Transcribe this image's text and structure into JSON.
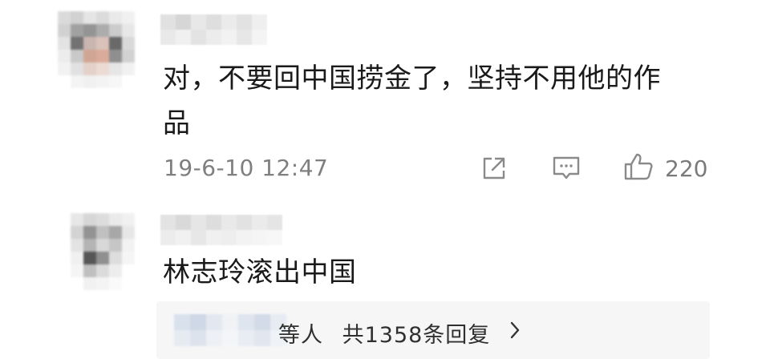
{
  "comments": [
    {
      "text_line1": "对，不要回中国捞金了，坚持不用他的作",
      "text_line2": "品",
      "timestamp": "19-6-10 12:47",
      "actions": {
        "share_icon": "share-icon",
        "reply_icon": "comment-icon",
        "like_icon": "thumbs-up-icon",
        "like_count": "220"
      }
    },
    {
      "text_line1": "林志玲滚出中国"
    }
  ],
  "reply_summary": {
    "label_suffix": "等人",
    "count_text": "共1358条回复",
    "chevron_icon": "chevron-right-icon"
  },
  "colors": {
    "text": "#1a1a1a",
    "meta": "#7f7f7f",
    "reply_bg": "#f6f6f7"
  }
}
